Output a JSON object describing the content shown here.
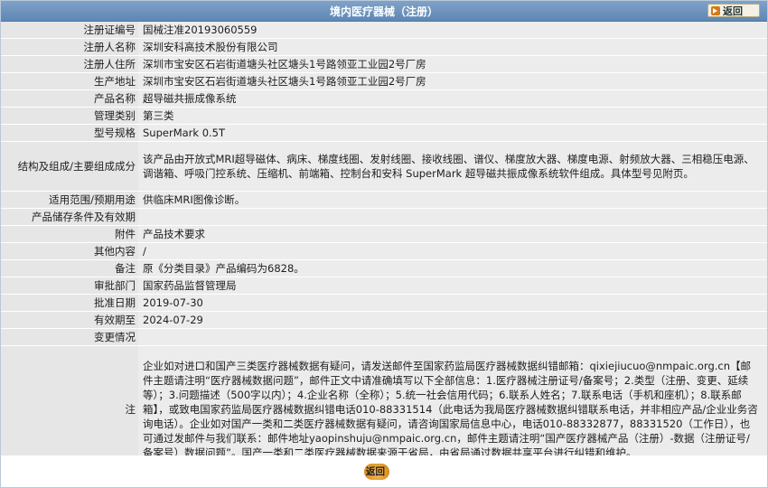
{
  "header": {
    "title": "境内医疗器械（注册）",
    "back_label": "返回"
  },
  "rows": {
    "reg_no": {
      "label": "注册证编号",
      "value": "国械注准20193060559"
    },
    "registrant": {
      "label": "注册人名称",
      "value": "深圳安科高技术股份有限公司"
    },
    "registrant_address": {
      "label": "注册人住所",
      "value": "深圳市宝安区石岩街道塘头社区塘头1号路领亚工业园2号厂房"
    },
    "production_address": {
      "label": "生产地址",
      "value": "深圳市宝安区石岩街道塘头社区塘头1号路领亚工业园2号厂房"
    },
    "product_name": {
      "label": "产品名称",
      "value": "超导磁共振成像系统"
    },
    "class": {
      "label": "管理类别",
      "value": "第三类"
    },
    "model": {
      "label": "型号规格",
      "value": "SuperMark 0.5T"
    },
    "structure": {
      "label": "结构及组成/主要组成成分",
      "value": "该产品由开放式MRI超导磁体、病床、梯度线圈、发射线圈、接收线圈、谱仪、梯度放大器、梯度电源、射频放大器、三相稳压电源、调谐箱、呼吸门控系统、压缩机、前端箱、控制台和安科 SuperMark 超导磁共振成像系统软件组成。具体型号见附页。"
    },
    "scope": {
      "label": "适用范围/预期用途",
      "value": "供临床MRI图像诊断。"
    },
    "storage": {
      "label": "产品储存条件及有效期",
      "value": ""
    },
    "attachment": {
      "label": "附件",
      "value": "产品技术要求"
    },
    "other": {
      "label": "其他内容",
      "value": "/"
    },
    "remark": {
      "label": "备注",
      "value": "原《分类目录》产品编码为6828。"
    },
    "approval_dept": {
      "label": "审批部门",
      "value": "国家药品监督管理局"
    },
    "approval_date": {
      "label": "批准日期",
      "value": "2019-07-30"
    },
    "valid_until": {
      "label": "有效期至",
      "value": "2024-07-29"
    },
    "changes": {
      "label": "变更情况",
      "value": ""
    },
    "note": {
      "label": "注",
      "value": "企业如对进口和国产三类医疗器械数据有疑问，请发送邮件至国家药监局医疗器械数据纠错邮箱：qixiejiucuo@nmpaic.org.cn【邮件主题请注明“医疗器械数据问题”，邮件正文中请准确填写以下全部信息：1.医疗器械注册证号/备案号；2.类型（注册、变更、延续等）；3.问题描述（500字以内）；4.企业名称（全称）；5.统一社会信用代码；6.联系人姓名；7.联系电话（手机和座机）；8.联系邮箱】，或致电国家药监局医疗器械数据纠错电话010-88331514（此电话为我局医疗器械数据纠错联系电话，并非相应产品/企业业务咨询电话）。企业如对国产一类和二类医疗器械数据有疑问，请咨询国家局信息中心，电话010-88332877，88331520（工作日），也可通过发邮件与我们联系：邮件地址yaopinshuju@nmpaic.org.cn，邮件主题请注明“国产医疗器械产品（注册）-数据（注册证号/备案号）数据问题”。国产一类和二类医疗器械数据来源于省局，由省局通过数据共享平台进行纠错和维护。"
    }
  },
  "footer": {
    "back_label": "返回"
  },
  "colors": {
    "header_bg": "#6f95bf",
    "label_bg": "#e6e6e6",
    "value_bg": "#ececec",
    "back_button": "#e39a27"
  },
  "icons": {
    "back_top": "back-arrow-icon"
  }
}
